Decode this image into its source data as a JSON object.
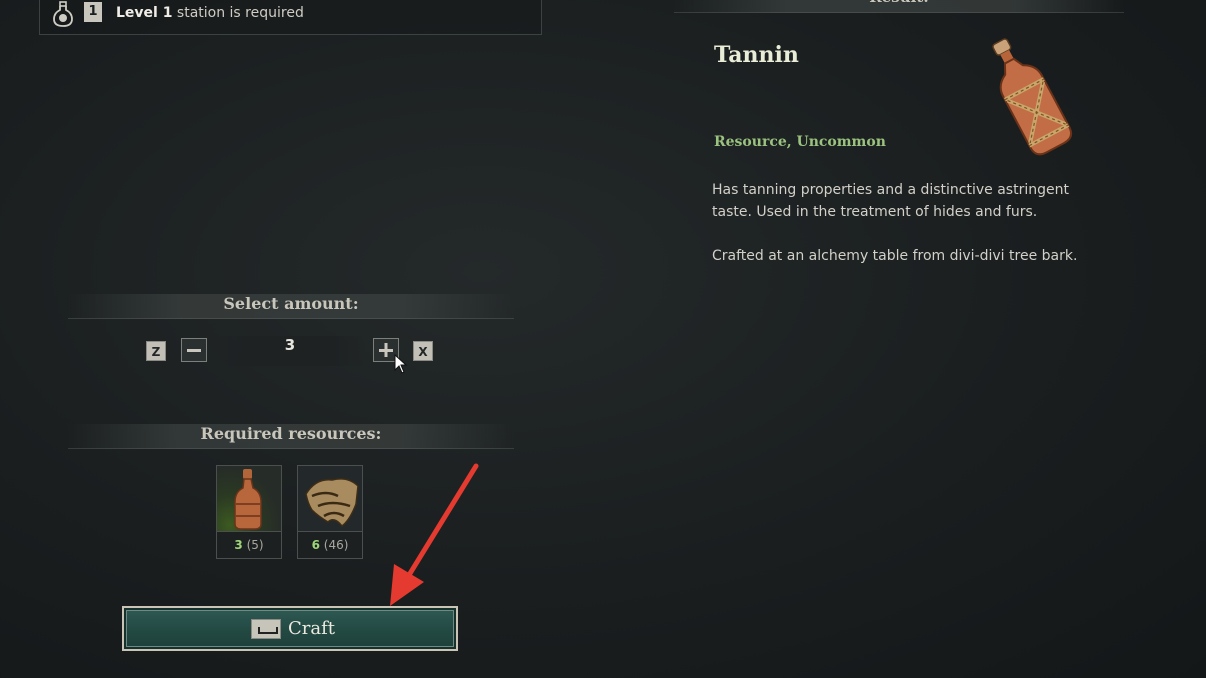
{
  "station": {
    "level_badge": "1",
    "level_label": "Level 1",
    "requirement_text": "station is required"
  },
  "amount": {
    "section_title": "Select amount:",
    "decrease_key": "Z",
    "increase_key": "X",
    "value": "3"
  },
  "resources": {
    "section_title": "Required resources:",
    "items": [
      {
        "icon": "wooden-bottle-icon",
        "have": "3",
        "total": "(5)"
      },
      {
        "icon": "bark-hide-icon",
        "have": "6",
        "total": "(46)"
      }
    ]
  },
  "craft": {
    "label": "Craft",
    "key_icon": "space-key-icon"
  },
  "result": {
    "section_title": "Result:",
    "name": "Tannin",
    "type": "Resource, Uncommon",
    "description": [
      "Has tanning properties and a distinctive astringent taste. Used in the treatment of hides and furs.",
      "Crafted at an alchemy table from divi-divi tree bark."
    ]
  },
  "colors": {
    "accent_green": "#9bc27f",
    "craft_button": "#2f5a54",
    "arrow": "#e53a2f"
  }
}
